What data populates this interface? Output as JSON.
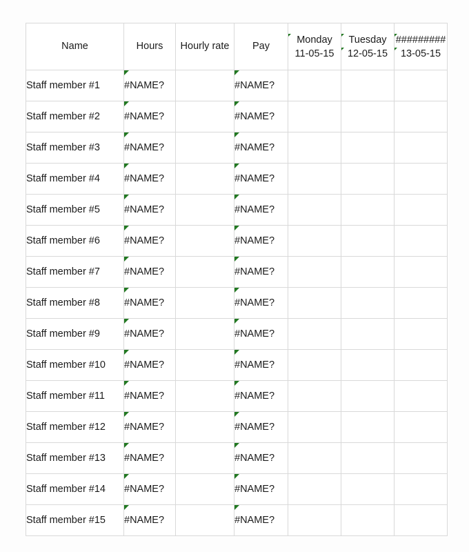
{
  "sheet": {
    "columns": [
      {
        "key": "name",
        "label": "Name",
        "class": "c-name"
      },
      {
        "key": "hours",
        "label": "Hours",
        "class": "c-hours"
      },
      {
        "key": "rate",
        "label": "Hourly rate",
        "class": "c-rate"
      },
      {
        "key": "pay",
        "label": "Pay",
        "class": "c-pay"
      }
    ],
    "header": {
      "name": "Name",
      "hours": "Hours",
      "rate": "Hourly rate",
      "pay": "Pay",
      "days": [
        {
          "day_label": "Monday",
          "date": "11-05-15",
          "overflow": false,
          "marker": "error-indicator"
        },
        {
          "day_label": "Tuesday",
          "date": "12-05-15",
          "overflow": false,
          "marker": "error-indicator"
        },
        {
          "day_label": "#########",
          "date": "13-05-15",
          "overflow": true,
          "marker": "error-indicator"
        }
      ]
    },
    "error_value": "#NAME?",
    "marker_color": "#217821",
    "border_color": "#d9d9d9",
    "cell_background": "#ffffff",
    "page_background": "#fdfdfd",
    "text_color": "#1b1b1b",
    "rows": [
      {
        "name": "Staff member #1",
        "hours": "#NAME?",
        "rate": "",
        "pay": "#NAME?",
        "day1": "",
        "day2": "",
        "day3": ""
      },
      {
        "name": "Staff member #2",
        "hours": "#NAME?",
        "rate": "",
        "pay": "#NAME?",
        "day1": "",
        "day2": "",
        "day3": ""
      },
      {
        "name": "Staff member #3",
        "hours": "#NAME?",
        "rate": "",
        "pay": "#NAME?",
        "day1": "",
        "day2": "",
        "day3": ""
      },
      {
        "name": "Staff member #4",
        "hours": "#NAME?",
        "rate": "",
        "pay": "#NAME?",
        "day1": "",
        "day2": "",
        "day3": ""
      },
      {
        "name": "Staff member #5",
        "hours": "#NAME?",
        "rate": "",
        "pay": "#NAME?",
        "day1": "",
        "day2": "",
        "day3": ""
      },
      {
        "name": "Staff member #6",
        "hours": "#NAME?",
        "rate": "",
        "pay": "#NAME?",
        "day1": "",
        "day2": "",
        "day3": ""
      },
      {
        "name": "Staff member #7",
        "hours": "#NAME?",
        "rate": "",
        "pay": "#NAME?",
        "day1": "",
        "day2": "",
        "day3": ""
      },
      {
        "name": "Staff member #8",
        "hours": "#NAME?",
        "rate": "",
        "pay": "#NAME?",
        "day1": "",
        "day2": "",
        "day3": ""
      },
      {
        "name": "Staff member #9",
        "hours": "#NAME?",
        "rate": "",
        "pay": "#NAME?",
        "day1": "",
        "day2": "",
        "day3": ""
      },
      {
        "name": "Staff member #10",
        "hours": "#NAME?",
        "rate": "",
        "pay": "#NAME?",
        "day1": "",
        "day2": "",
        "day3": ""
      },
      {
        "name": "Staff member #11",
        "hours": "#NAME?",
        "rate": "",
        "pay": "#NAME?",
        "day1": "",
        "day2": "",
        "day3": ""
      },
      {
        "name": "Staff member #12",
        "hours": "#NAME?",
        "rate": "",
        "pay": "#NAME?",
        "day1": "",
        "day2": "",
        "day3": ""
      },
      {
        "name": "Staff member #13",
        "hours": "#NAME?",
        "rate": "",
        "pay": "#NAME?",
        "day1": "",
        "day2": "",
        "day3": ""
      },
      {
        "name": "Staff member #14",
        "hours": "#NAME?",
        "rate": "",
        "pay": "#NAME?",
        "day1": "",
        "day2": "",
        "day3": ""
      },
      {
        "name": "Staff member #15",
        "hours": "#NAME?",
        "rate": "",
        "pay": "#NAME?",
        "day1": "",
        "day2": "",
        "day3": ""
      }
    ]
  }
}
